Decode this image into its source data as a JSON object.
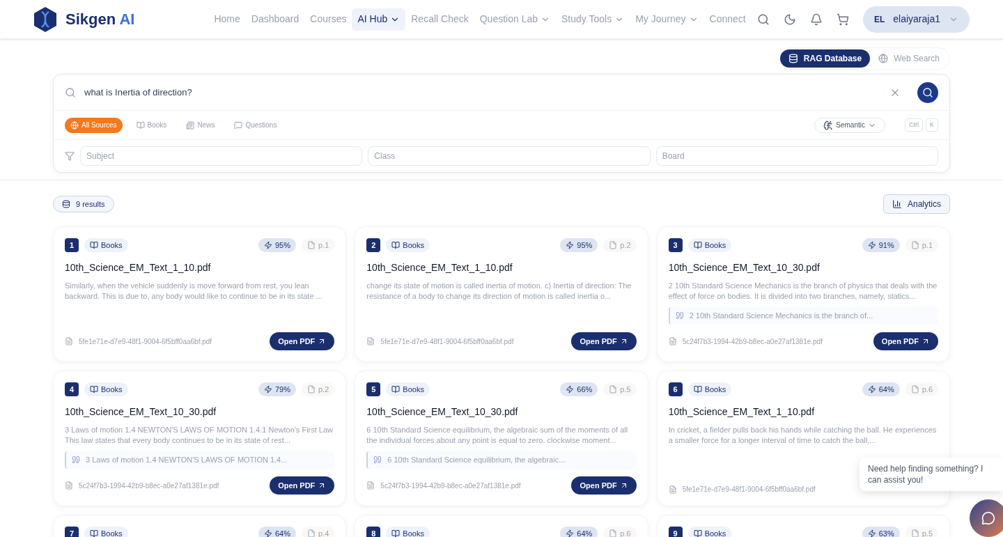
{
  "brand": {
    "name": "Sikgen",
    "accent": "AI"
  },
  "nav": [
    {
      "label": "Home",
      "selected": false,
      "dropdown": false
    },
    {
      "label": "Dashboard",
      "selected": false,
      "dropdown": false
    },
    {
      "label": "Courses",
      "selected": false,
      "dropdown": false
    },
    {
      "label": "AI Hub",
      "selected": true,
      "dropdown": true
    },
    {
      "label": "Recall Check",
      "selected": false,
      "dropdown": false
    },
    {
      "label": "Question Lab",
      "selected": false,
      "dropdown": true
    },
    {
      "label": "Study Tools",
      "selected": false,
      "dropdown": true
    },
    {
      "label": "My Journey",
      "selected": false,
      "dropdown": true
    },
    {
      "label": "Connect",
      "selected": false,
      "dropdown": false
    }
  ],
  "user": {
    "initials": "EL",
    "name": "elaiyaraja1"
  },
  "mode_toggle": [
    {
      "label": "RAG Database",
      "selected": true,
      "kind": "database"
    },
    {
      "label": "Web Search",
      "selected": false,
      "kind": "globe"
    }
  ],
  "search": {
    "value": "what is Inertia of direction?"
  },
  "sources": [
    {
      "label": "All Sources",
      "selected": true,
      "kind": "globe"
    },
    {
      "label": "Books",
      "selected": false,
      "kind": "book"
    },
    {
      "label": "News",
      "selected": false,
      "kind": "news"
    },
    {
      "label": "Questions",
      "selected": false,
      "kind": "chat"
    }
  ],
  "search_mode": "Semantic",
  "shortcut": [
    "Ctrl",
    "K"
  ],
  "filters": [
    {
      "placeholder": "Subject"
    },
    {
      "placeholder": "Class"
    },
    {
      "placeholder": "Board"
    }
  ],
  "results_count": "9 results",
  "analytics_button": "Analytics",
  "results": [
    {
      "index": "1",
      "type": "Books",
      "score": "95%",
      "page": "p.1",
      "title": "10th_Science_EM_Text_1_10.pdf",
      "snippet": "Similarly, when the vehicle suddenly is move forward from rest, you lean backward. This is due to, any body would like to continue to be in its state ...",
      "file": "5fe1e71e-d7e9-48f1-9004-6f5bff0aa6bf.pdf",
      "button": "Open PDF"
    },
    {
      "index": "2",
      "type": "Books",
      "score": "95%",
      "page": "p.2",
      "title": "10th_Science_EM_Text_1_10.pdf",
      "snippet": "change its state of motion is called inertia of motion. c) Inertia of direction: The resistance of a body to change its direction of motion is called inertia o...",
      "file": "5fe1e71e-d7e9-48f1-9004-6f5bff0aa6bf.pdf",
      "button": "Open PDF"
    },
    {
      "index": "3",
      "type": "Books",
      "score": "91%",
      "page": "p.1",
      "title": "10th_Science_EM_Text_10_30.pdf",
      "snippet": "2 10th Standard Science Mechanics is the branch of physics that deals with the effect of force on bodies. It is divided into two branches, namely, statics...",
      "quote": "2 10th Standard Science Mechanics is the branch of...",
      "file": "5c24f7b3-1994-42b9-b8ec-a0e27af1381e.pdf",
      "button": "Open PDF"
    },
    {
      "index": "4",
      "type": "Books",
      "score": "79%",
      "page": "p.2",
      "title": "10th_Science_EM_Text_10_30.pdf",
      "snippet": "3 Laws of motion 1.4    NEWTON'S LAWS OF MOTION 1.4.1   Newton's First Law This law states that every body continues to be in its state of rest...",
      "quote": "3 Laws of motion 1.4    NEWTON'S LAWS OF MOTION 1.4...",
      "file": "5c24f7b3-1994-42b9-b8ec-a0e27af1381e.pdf",
      "button": "Open PDF"
    },
    {
      "index": "5",
      "type": "Books",
      "score": "66%",
      "page": "p.5",
      "title": "10th_Science_EM_Text_10_30.pdf",
      "snippet": "6 10th Standard Science equilibrium, the algebraic sum of the moments of all the individual forces about any point is equal to zero. clockwise moment...",
      "quote": "6 10th Standard Science equilibrium, the algebraic...",
      "file": "5c24f7b3-1994-42b9-b8ec-a0e27af1381e.pdf",
      "button": "Open PDF"
    },
    {
      "index": "6",
      "type": "Books",
      "score": "64%",
      "page": "p.6",
      "title": "10th_Science_EM_Text_1_10.pdf",
      "snippet": "In cricket, a fielder pulls back his hands while catching the ball. He experiences a smaller force for a longer interval of time to catch the ball,...",
      "file": "5fe1e71e-d7e9-48f1-9004-6f5bff0aa6bf.pdf"
    },
    {
      "index": "7",
      "type": "Books",
      "score": "64%",
      "page": "p.4"
    },
    {
      "index": "8",
      "type": "Books",
      "score": "64%",
      "page": "p.6"
    },
    {
      "index": "9",
      "type": "Books",
      "score": "63%",
      "page": "p.5"
    }
  ],
  "assistant": {
    "message": "Need help finding something? I can assist you!"
  }
}
